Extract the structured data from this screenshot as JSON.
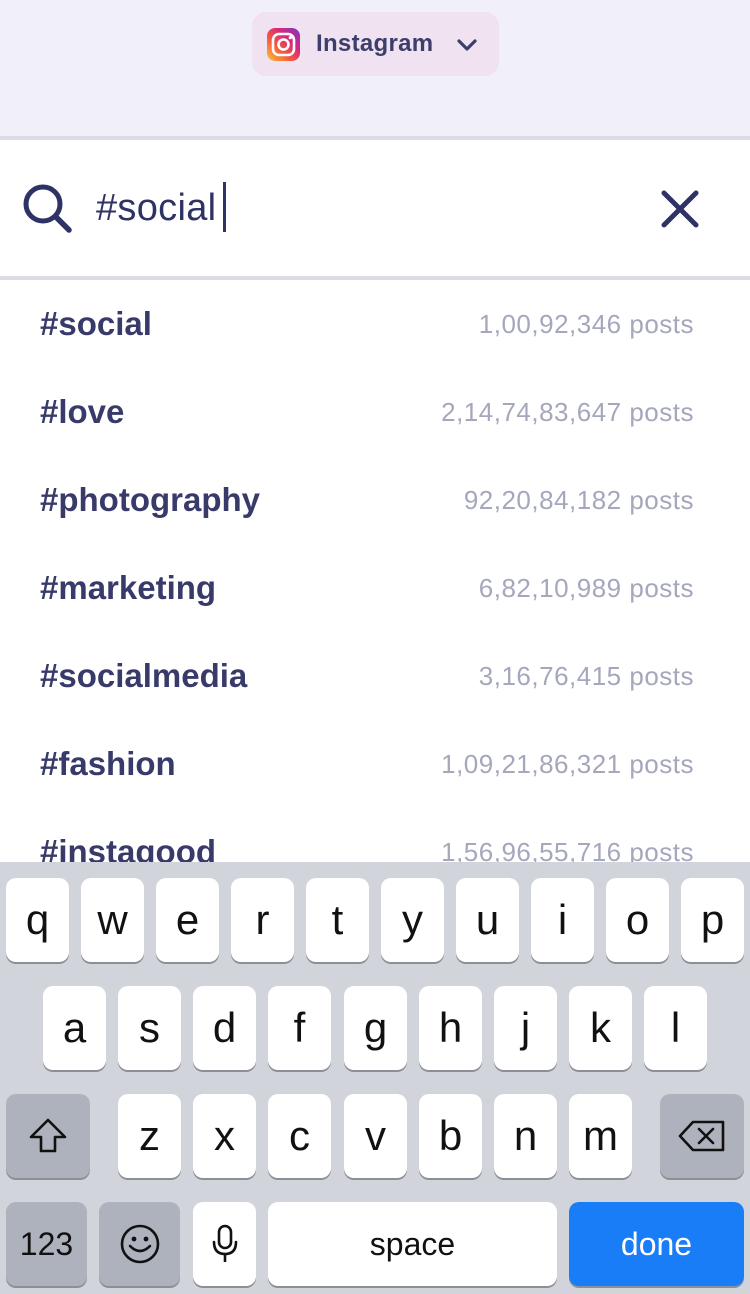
{
  "header": {
    "account_name": "Instagram",
    "account_icon": "instagram-icon",
    "dropdown_icon": "chevron-down-icon",
    "pill_color": "#f1e2f1",
    "text_color": "#3c3f6b"
  },
  "search": {
    "query": "#social",
    "search_icon": "search-icon",
    "clear_icon": "close-icon"
  },
  "results": [
    {
      "tag": "#social",
      "count": "1,00,92,346 posts"
    },
    {
      "tag": "#love",
      "count": "2,14,74,83,647 posts"
    },
    {
      "tag": "#photography",
      "count": "92,20,84,182 posts"
    },
    {
      "tag": "#marketing",
      "count": "6,82,10,989 posts"
    },
    {
      "tag": "#socialmedia",
      "count": "3,16,76,415 posts"
    },
    {
      "tag": "#fashion",
      "count": "1,09,21,86,321 posts"
    },
    {
      "tag": "#instagood",
      "count": "1,56,96,55,716 posts"
    }
  ],
  "keyboard": {
    "row1": [
      "q",
      "w",
      "e",
      "r",
      "t",
      "y",
      "u",
      "i",
      "o",
      "p"
    ],
    "row2": [
      "a",
      "s",
      "d",
      "f",
      "g",
      "h",
      "j",
      "k",
      "l"
    ],
    "row3": [
      "z",
      "x",
      "c",
      "v",
      "b",
      "n",
      "m"
    ],
    "numbers_label": "123",
    "space_label": "space",
    "done_label": "done",
    "done_color": "#1a7df8"
  }
}
